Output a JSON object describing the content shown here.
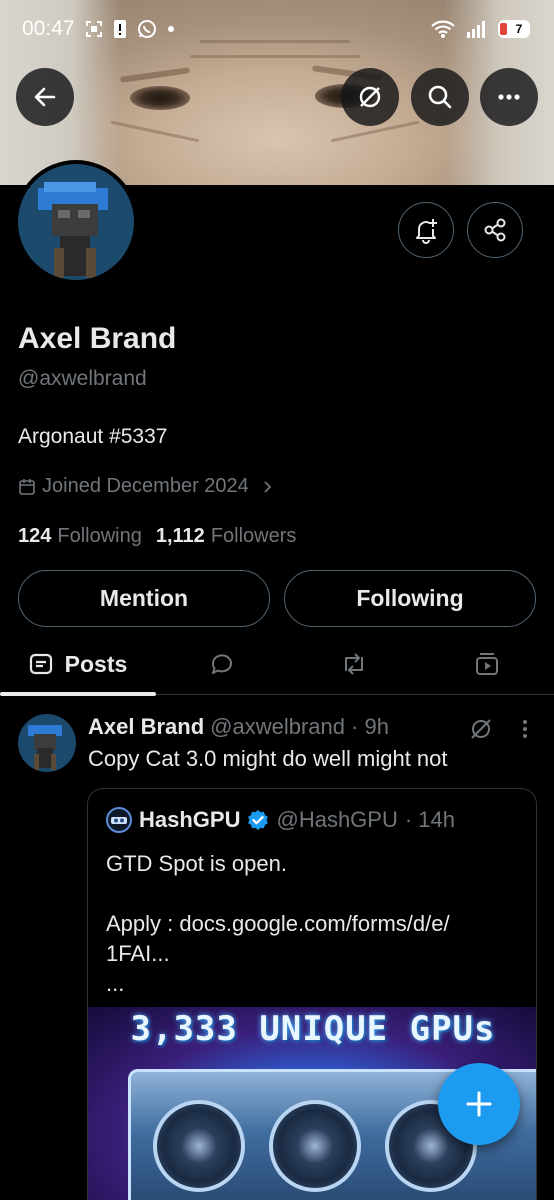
{
  "status_bar": {
    "time": "00:47",
    "battery_level": "7"
  },
  "profile": {
    "name": "Axel Brand",
    "handle": "@axwelbrand",
    "bio": "Argonaut #5337",
    "joined": "Joined December 2024",
    "following_count": "124",
    "following_label": "Following",
    "followers_count": "1,112",
    "followers_label": "Followers"
  },
  "actions": {
    "mention_label": "Mention",
    "following_label": "Following"
  },
  "tabs": [
    {
      "label": "Posts",
      "icon": "posts-icon",
      "active": true
    },
    {
      "label": "",
      "icon": "replies-icon"
    },
    {
      "label": "",
      "icon": "reposts-icon"
    },
    {
      "label": "",
      "icon": "media-icon"
    }
  ],
  "post": {
    "author_name": "Axel Brand",
    "author_handle": "@axwelbrand",
    "time": "· 9h",
    "text": "Copy Cat 3.0 might do well might not",
    "quote": {
      "author_name": "HashGPU",
      "author_handle": "@HashGPU",
      "time": "· 14h",
      "line1": "GTD Spot is open.",
      "line2": "Apply : docs.google.com/forms/d/e/",
      "line3": "1FAI...",
      "line4": "...",
      "image_title": "3,333 UNIQUE GPUs"
    }
  },
  "colors": {
    "accent": "#1d9bf0",
    "background": "#000000",
    "muted": "#71767b",
    "border": "#536471"
  }
}
